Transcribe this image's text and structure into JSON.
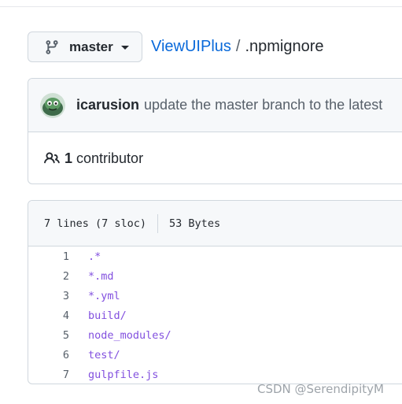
{
  "branch": {
    "label": "master"
  },
  "breadcrumb": {
    "repo": "ViewUIPlus",
    "separator": "/",
    "file": ".npmignore"
  },
  "commit": {
    "author": "icarusion",
    "message": "update the master branch to the latest"
  },
  "contributors": {
    "count": "1",
    "label": "contributor"
  },
  "file_info": {
    "lines": "7 lines (7 sloc)",
    "size": "53 Bytes"
  },
  "code_lines": [
    {
      "num": "1",
      "text": ".*"
    },
    {
      "num": "2",
      "text": "*.md"
    },
    {
      "num": "3",
      "text": "*.yml"
    },
    {
      "num": "4",
      "text": "build/"
    },
    {
      "num": "5",
      "text": "node_modules/"
    },
    {
      "num": "6",
      "text": "test/"
    },
    {
      "num": "7",
      "text": "gulpfile.js"
    }
  ],
  "watermark": "CSDN @SerendipityM",
  "icons": {
    "branch": "git-branch-icon",
    "caret": "caret-down-icon",
    "people": "people-icon"
  },
  "colors": {
    "link": "#0969da",
    "code": "#8250df",
    "muted": "#57606a"
  }
}
